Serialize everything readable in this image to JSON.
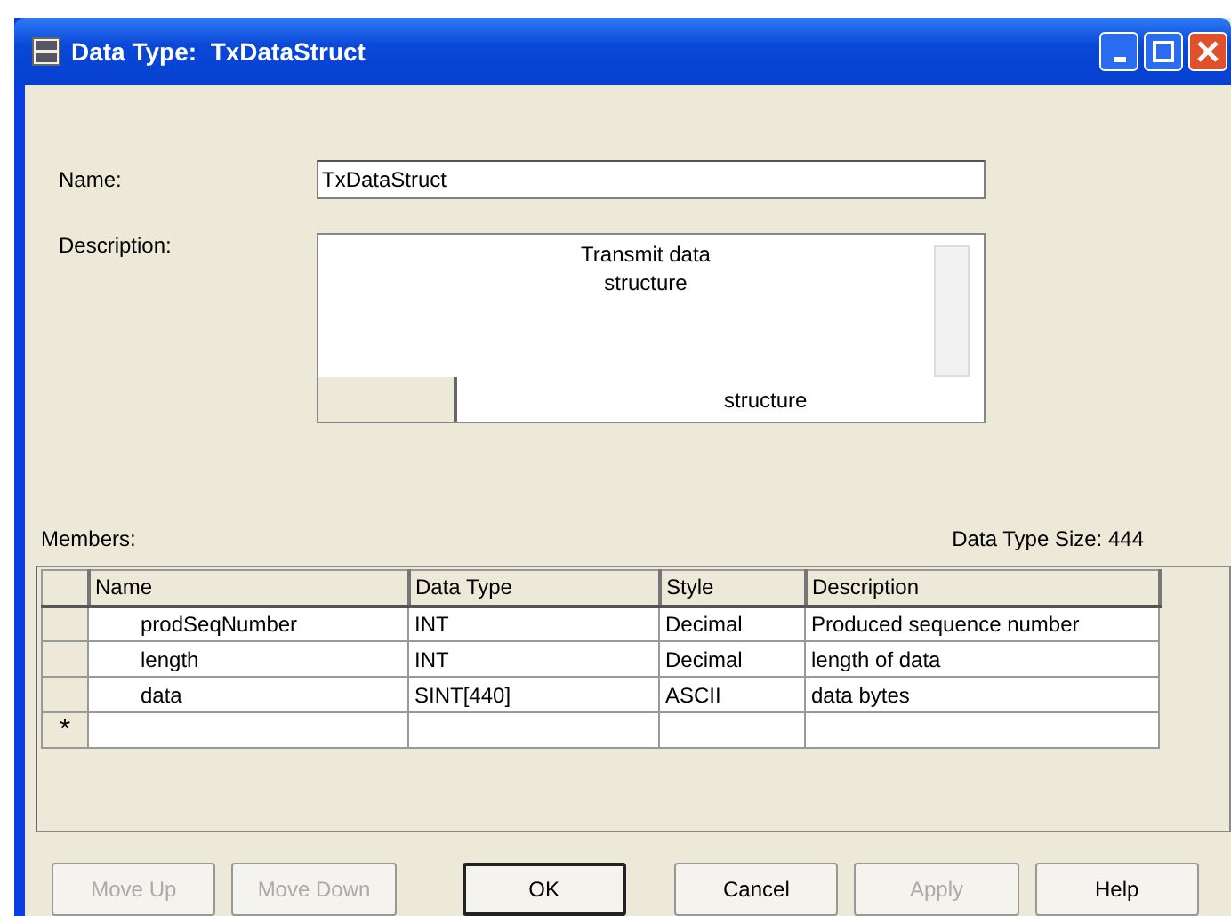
{
  "window": {
    "title": "Data Type:  TxDataStruct"
  },
  "name": {
    "label": "Name:",
    "value": "TxDataStruct"
  },
  "description": {
    "label": "Description:",
    "value": "Transmit data structure",
    "overflow_text": "structure"
  },
  "members": {
    "label": "Members:",
    "size_text": "Data Type Size: 444",
    "columns": [
      "Name",
      "Data Type",
      "Style",
      "Description"
    ],
    "rows": [
      {
        "marker": "",
        "cells": [
          "prodSeqNumber",
          "INT",
          "Decimal",
          "Produced sequence number"
        ]
      },
      {
        "marker": "",
        "cells": [
          "length",
          "INT",
          "Decimal",
          "length of data"
        ]
      },
      {
        "marker": "",
        "cells": [
          "data",
          "SINT[440]",
          "ASCII",
          "data bytes"
        ]
      },
      {
        "marker": "*",
        "cells": [
          "",
          "",
          "",
          ""
        ]
      }
    ]
  },
  "buttons": [
    {
      "label": "Move Up",
      "disabled": true,
      "default": false
    },
    {
      "label": "Move Down",
      "disabled": true,
      "default": false
    },
    {
      "label": "OK",
      "disabled": false,
      "default": true
    },
    {
      "label": "Cancel",
      "disabled": false,
      "default": false
    },
    {
      "label": "Apply",
      "disabled": true,
      "default": false
    },
    {
      "label": "Help",
      "disabled": false,
      "default": false
    }
  ]
}
